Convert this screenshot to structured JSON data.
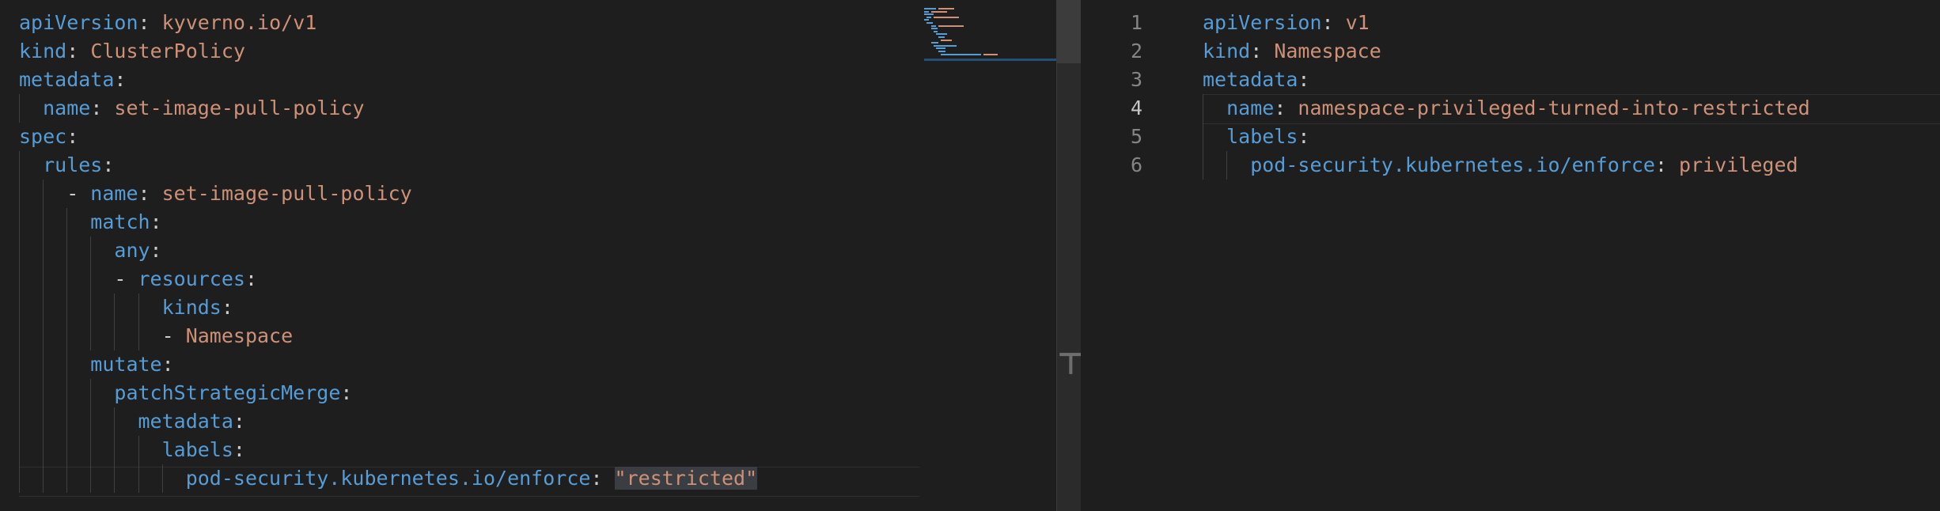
{
  "left_editor": {
    "lines": [
      {
        "indent": 0,
        "key": "apiVersion",
        "value": "kyverno.io/v1"
      },
      {
        "indent": 0,
        "key": "kind",
        "value": "ClusterPolicy"
      },
      {
        "indent": 0,
        "key": "metadata",
        "value": ""
      },
      {
        "indent": 1,
        "key": "name",
        "value": "set-image-pull-policy"
      },
      {
        "indent": 0,
        "key": "spec",
        "value": ""
      },
      {
        "indent": 1,
        "key": "rules",
        "value": ""
      },
      {
        "indent": 2,
        "dash": true,
        "key": "name",
        "value": "set-image-pull-policy"
      },
      {
        "indent": 3,
        "key": "match",
        "value": ""
      },
      {
        "indent": 4,
        "key": "any",
        "value": ""
      },
      {
        "indent": 4,
        "dash": true,
        "key": "resources",
        "value": ""
      },
      {
        "indent": 6,
        "key": "kinds",
        "value": ""
      },
      {
        "indent": 6,
        "dash": true,
        "key": "",
        "value": "Namespace"
      },
      {
        "indent": 3,
        "key": "mutate",
        "value": ""
      },
      {
        "indent": 4,
        "key": "patchStrategicMerge",
        "value": ""
      },
      {
        "indent": 5,
        "key": "metadata",
        "value": ""
      },
      {
        "indent": 6,
        "key": "labels",
        "value": ""
      },
      {
        "indent": 7,
        "key": "pod-security.kubernetes.io/enforce",
        "value": "\"restricted\"",
        "selected": true
      }
    ]
  },
  "right_editor": {
    "line_numbers": [
      "1",
      "2",
      "3",
      "4",
      "5",
      "6"
    ],
    "current_line": 4,
    "lines": [
      {
        "indent": 0,
        "key": "apiVersion",
        "value": "v1"
      },
      {
        "indent": 0,
        "key": "kind",
        "value": "Namespace"
      },
      {
        "indent": 0,
        "key": "metadata",
        "value": ""
      },
      {
        "indent": 1,
        "key": "name",
        "value": "namespace-privileged-turned-into-restricted"
      },
      {
        "indent": 1,
        "key": "labels",
        "value": ""
      },
      {
        "indent": 2,
        "key": "pod-security.kubernetes.io/enforce",
        "value": "privileged"
      }
    ]
  },
  "colors": {
    "background": "#1e1e1e",
    "key": "#569cd6",
    "value": "#ce9178",
    "punctuation": "#cccccc",
    "line_number": "#858585",
    "selection": "#3a3d41"
  },
  "splitter_icon": "sash-handle-icon"
}
